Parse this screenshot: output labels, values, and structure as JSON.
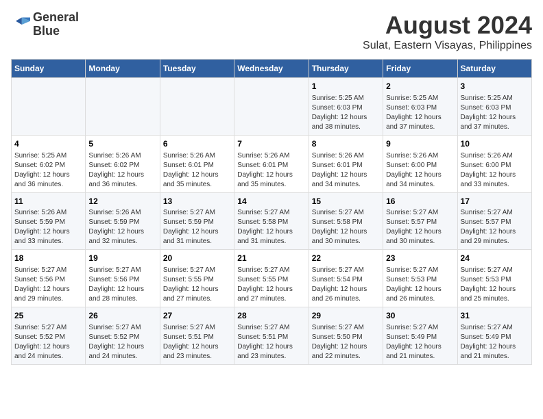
{
  "logo": {
    "line1": "General",
    "line2": "Blue"
  },
  "title": "August 2024",
  "subtitle": "Sulat, Eastern Visayas, Philippines",
  "days_of_week": [
    "Sunday",
    "Monday",
    "Tuesday",
    "Wednesday",
    "Thursday",
    "Friday",
    "Saturday"
  ],
  "weeks": [
    [
      {
        "day": "",
        "info": ""
      },
      {
        "day": "",
        "info": ""
      },
      {
        "day": "",
        "info": ""
      },
      {
        "day": "",
        "info": ""
      },
      {
        "day": "1",
        "info": "Sunrise: 5:25 AM\nSunset: 6:03 PM\nDaylight: 12 hours\nand 38 minutes."
      },
      {
        "day": "2",
        "info": "Sunrise: 5:25 AM\nSunset: 6:03 PM\nDaylight: 12 hours\nand 37 minutes."
      },
      {
        "day": "3",
        "info": "Sunrise: 5:25 AM\nSunset: 6:03 PM\nDaylight: 12 hours\nand 37 minutes."
      }
    ],
    [
      {
        "day": "4",
        "info": "Sunrise: 5:25 AM\nSunset: 6:02 PM\nDaylight: 12 hours\nand 36 minutes."
      },
      {
        "day": "5",
        "info": "Sunrise: 5:26 AM\nSunset: 6:02 PM\nDaylight: 12 hours\nand 36 minutes."
      },
      {
        "day": "6",
        "info": "Sunrise: 5:26 AM\nSunset: 6:01 PM\nDaylight: 12 hours\nand 35 minutes."
      },
      {
        "day": "7",
        "info": "Sunrise: 5:26 AM\nSunset: 6:01 PM\nDaylight: 12 hours\nand 35 minutes."
      },
      {
        "day": "8",
        "info": "Sunrise: 5:26 AM\nSunset: 6:01 PM\nDaylight: 12 hours\nand 34 minutes."
      },
      {
        "day": "9",
        "info": "Sunrise: 5:26 AM\nSunset: 6:00 PM\nDaylight: 12 hours\nand 34 minutes."
      },
      {
        "day": "10",
        "info": "Sunrise: 5:26 AM\nSunset: 6:00 PM\nDaylight: 12 hours\nand 33 minutes."
      }
    ],
    [
      {
        "day": "11",
        "info": "Sunrise: 5:26 AM\nSunset: 5:59 PM\nDaylight: 12 hours\nand 33 minutes."
      },
      {
        "day": "12",
        "info": "Sunrise: 5:26 AM\nSunset: 5:59 PM\nDaylight: 12 hours\nand 32 minutes."
      },
      {
        "day": "13",
        "info": "Sunrise: 5:27 AM\nSunset: 5:59 PM\nDaylight: 12 hours\nand 31 minutes."
      },
      {
        "day": "14",
        "info": "Sunrise: 5:27 AM\nSunset: 5:58 PM\nDaylight: 12 hours\nand 31 minutes."
      },
      {
        "day": "15",
        "info": "Sunrise: 5:27 AM\nSunset: 5:58 PM\nDaylight: 12 hours\nand 30 minutes."
      },
      {
        "day": "16",
        "info": "Sunrise: 5:27 AM\nSunset: 5:57 PM\nDaylight: 12 hours\nand 30 minutes."
      },
      {
        "day": "17",
        "info": "Sunrise: 5:27 AM\nSunset: 5:57 PM\nDaylight: 12 hours\nand 29 minutes."
      }
    ],
    [
      {
        "day": "18",
        "info": "Sunrise: 5:27 AM\nSunset: 5:56 PM\nDaylight: 12 hours\nand 29 minutes."
      },
      {
        "day": "19",
        "info": "Sunrise: 5:27 AM\nSunset: 5:56 PM\nDaylight: 12 hours\nand 28 minutes."
      },
      {
        "day": "20",
        "info": "Sunrise: 5:27 AM\nSunset: 5:55 PM\nDaylight: 12 hours\nand 27 minutes."
      },
      {
        "day": "21",
        "info": "Sunrise: 5:27 AM\nSunset: 5:55 PM\nDaylight: 12 hours\nand 27 minutes."
      },
      {
        "day": "22",
        "info": "Sunrise: 5:27 AM\nSunset: 5:54 PM\nDaylight: 12 hours\nand 26 minutes."
      },
      {
        "day": "23",
        "info": "Sunrise: 5:27 AM\nSunset: 5:53 PM\nDaylight: 12 hours\nand 26 minutes."
      },
      {
        "day": "24",
        "info": "Sunrise: 5:27 AM\nSunset: 5:53 PM\nDaylight: 12 hours\nand 25 minutes."
      }
    ],
    [
      {
        "day": "25",
        "info": "Sunrise: 5:27 AM\nSunset: 5:52 PM\nDaylight: 12 hours\nand 24 minutes."
      },
      {
        "day": "26",
        "info": "Sunrise: 5:27 AM\nSunset: 5:52 PM\nDaylight: 12 hours\nand 24 minutes."
      },
      {
        "day": "27",
        "info": "Sunrise: 5:27 AM\nSunset: 5:51 PM\nDaylight: 12 hours\nand 23 minutes."
      },
      {
        "day": "28",
        "info": "Sunrise: 5:27 AM\nSunset: 5:51 PM\nDaylight: 12 hours\nand 23 minutes."
      },
      {
        "day": "29",
        "info": "Sunrise: 5:27 AM\nSunset: 5:50 PM\nDaylight: 12 hours\nand 22 minutes."
      },
      {
        "day": "30",
        "info": "Sunrise: 5:27 AM\nSunset: 5:49 PM\nDaylight: 12 hours\nand 21 minutes."
      },
      {
        "day": "31",
        "info": "Sunrise: 5:27 AM\nSunset: 5:49 PM\nDaylight: 12 hours\nand 21 minutes."
      }
    ]
  ]
}
